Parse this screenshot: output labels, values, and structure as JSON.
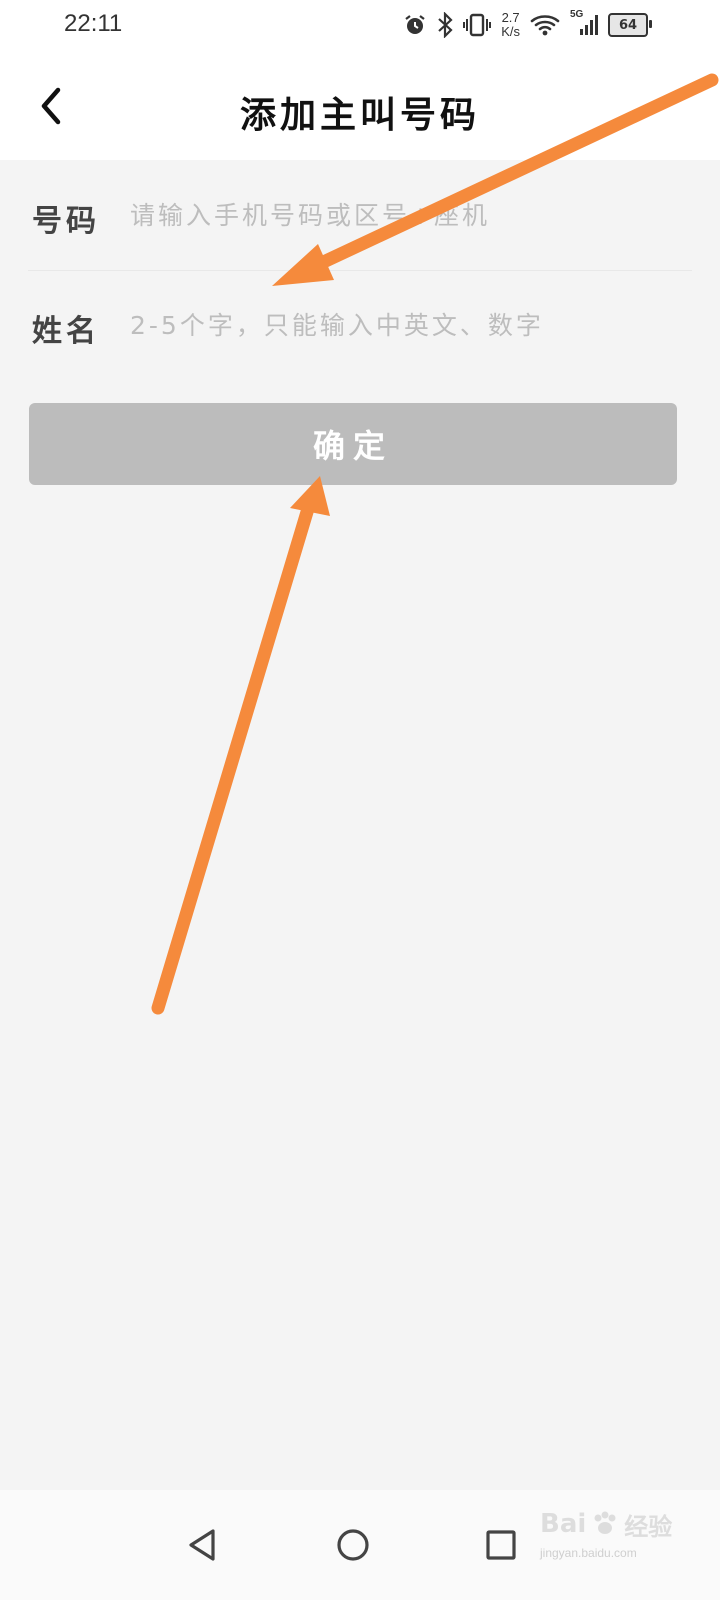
{
  "status_bar": {
    "time": "22:11",
    "net_speed_value": "2.7",
    "net_speed_unit": "K/s",
    "signal_type": "5G",
    "battery_level": "64",
    "icons": [
      "alarm-icon",
      "bluetooth-icon",
      "vibrate-icon",
      "wifi-icon",
      "cellular-signal-icon",
      "battery-icon"
    ]
  },
  "header": {
    "back_icon": "chevron-left-icon",
    "title": "添加主叫号码"
  },
  "form": {
    "phone": {
      "label": "号码",
      "placeholder": "请输入手机号码或区号+座机",
      "value": ""
    },
    "name": {
      "label": "姓名",
      "placeholder": "2-5个字，只能输入中英文、数字",
      "value": ""
    },
    "confirm_label": "确定",
    "confirm_color": "#bcbcbc"
  },
  "annotations": {
    "arrow_color": "#f58a3c"
  },
  "nav_bar": {
    "icons": [
      "nav-back-triangle-icon",
      "nav-home-circle-icon",
      "nav-recent-square-icon"
    ]
  },
  "watermark": {
    "brand": "Bai",
    "paw": "paw-icon",
    "suffix": "经验",
    "url": "jingyan.baidu.com"
  }
}
